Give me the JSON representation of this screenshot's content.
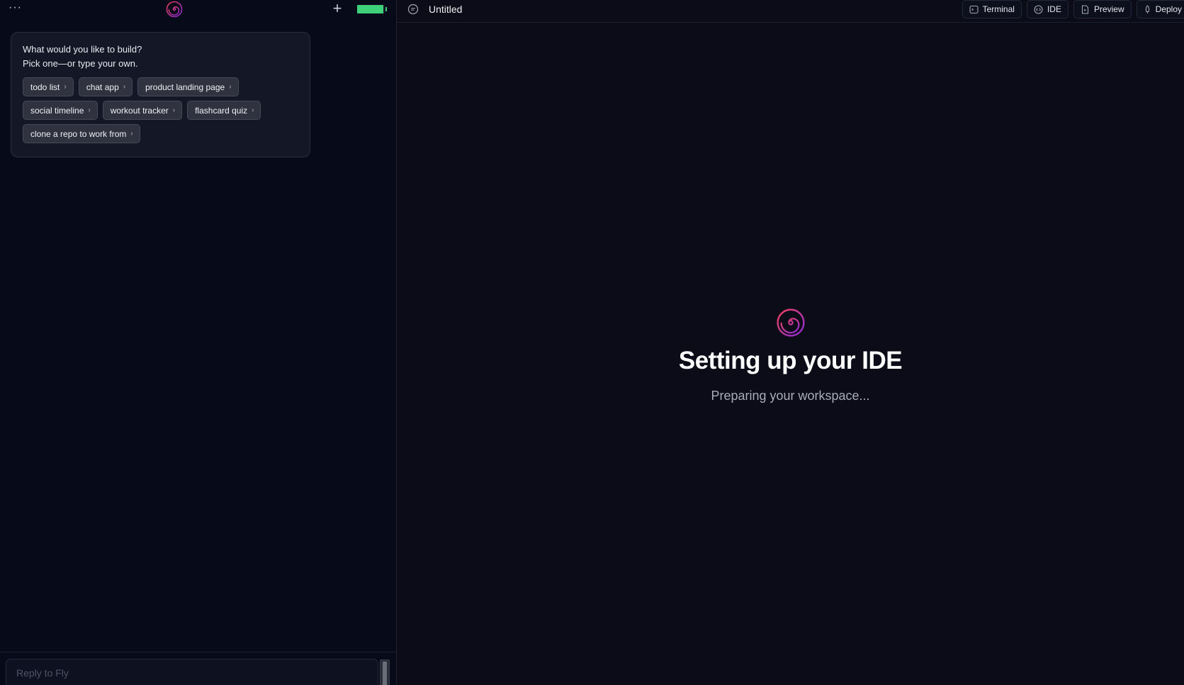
{
  "left": {
    "menu_glyph": "···",
    "add_glyph": "+",
    "battery_level": 0.95,
    "battery_color": "#3fd17a",
    "prompt_card": {
      "line1": "What would you like to build?",
      "line2": "Pick one—or type your own.",
      "suggestions": [
        "todo list",
        "chat app",
        "product landing page",
        "social timeline",
        "workout tracker",
        "flashcard quiz",
        "clone a repo to work from"
      ],
      "chevron": "›"
    },
    "composer": {
      "placeholder": "Reply to Fly"
    }
  },
  "right": {
    "title": "Untitled",
    "tabs": {
      "terminal": "Terminal",
      "ide": "IDE",
      "preview": "Preview",
      "deploy": "Deploy"
    },
    "loading": {
      "title": "Setting up your IDE",
      "subtitle": "Preparing your workspace..."
    }
  },
  "icons": {
    "menu": "more-horizontal-icon",
    "logo": "spiral-logo-icon",
    "add": "plus-icon",
    "battery": "battery-icon",
    "chat": "chat-bubble-icon",
    "terminal": "terminal-icon",
    "ide": "code-icon",
    "preview": "file-play-icon",
    "deploy": "rocket-icon"
  },
  "colors": {
    "brand_gradient_start": "#e03a55",
    "brand_gradient_end": "#8a2bd6",
    "left_bg": "#070a18",
    "right_bg": "#0b0c18"
  }
}
